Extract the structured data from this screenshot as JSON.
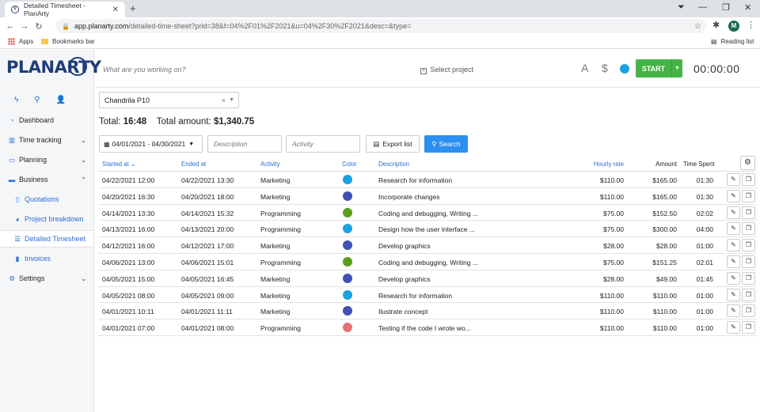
{
  "browser": {
    "tab_title": "Detailed Timesheet - PlanArty",
    "url_host": "app.planarty.com",
    "url_path": "/detailed-time-sheet?prid=38&f=04%2F01%2F2021&u=04%2F30%2F2021&desc=&type=",
    "profile_initial": "M",
    "bookmarks": {
      "apps": "Apps",
      "bookmarks_bar": "Bookmarks bar",
      "reading_list": "Reading list"
    }
  },
  "brand": {
    "logo": "PLANARTY"
  },
  "sidebar": {
    "items": [
      {
        "label": "Dashboard",
        "icon": "dashboard-icon"
      },
      {
        "label": "Time tracking",
        "icon": "chart-icon"
      },
      {
        "label": "Planning",
        "icon": "folder-icon"
      },
      {
        "label": "Business",
        "icon": "briefcase-icon"
      },
      {
        "label": "Quotations",
        "icon": "document-icon"
      },
      {
        "label": "Project breakdown",
        "icon": "pie-icon"
      },
      {
        "label": "Detailed Timesheet",
        "icon": "list-icon"
      },
      {
        "label": "Invoices",
        "icon": "invoice-icon"
      },
      {
        "label": "Settings",
        "icon": "gear-icon"
      }
    ]
  },
  "topbar": {
    "placeholder": "What are you working on?",
    "select_project": "Select project",
    "a_label": "A",
    "dollar_label": "$",
    "start_label": "START",
    "timer": "00:00:00",
    "accent": "#45b347"
  },
  "filters": {
    "project": "Chandrila P10",
    "total_label": "Total:",
    "total_time": "16:48",
    "amount_label": "Total amount:",
    "total_amount": "$1,340.75",
    "date_range": "04/01/2021 - 04/30/2021",
    "description_placeholder": "Description",
    "activity_placeholder": "Activity",
    "export_label": "Export list",
    "search_label": "Search"
  },
  "table": {
    "headers": {
      "started": "Started at",
      "ended": "Ended at",
      "activity": "Activity",
      "color": "Color",
      "description": "Description",
      "rate": "Hourly rate",
      "amount": "Amount",
      "time": "Time Spent"
    },
    "rows": [
      {
        "start": "04/22/2021  12:00",
        "end": "04/22/2021  13:30",
        "activity": "Marketing",
        "color": "#1ba1e2",
        "description": "Research for information",
        "rate": "$110.00",
        "amount": "$165.00",
        "time": "01:30"
      },
      {
        "start": "04/20/2021  16:30",
        "end": "04/20/2021  18:00",
        "activity": "Marketing",
        "color": "#3f51b5",
        "description": "Incorporate changes",
        "rate": "$110.00",
        "amount": "$165.00",
        "time": "01:30"
      },
      {
        "start": "04/14/2021  13:30",
        "end": "04/14/2021  15:32",
        "activity": "Programming",
        "color": "#5a9e1a",
        "description": "Coding and debugging, Writing ...",
        "rate": "$75.00",
        "amount": "$152.50",
        "time": "02:02"
      },
      {
        "start": "04/13/2021  16:00",
        "end": "04/13/2021  20:00",
        "activity": "Programming",
        "color": "#1ba1e2",
        "description": "Design how the user interface ...",
        "rate": "$75.00",
        "amount": "$300.00",
        "time": "04:00"
      },
      {
        "start": "04/12/2021  16:00",
        "end": "04/12/2021  17:00",
        "activity": "Marketing",
        "color": "#3f51b5",
        "description": "Develop graphics",
        "rate": "$28.00",
        "amount": "$28.00",
        "time": "01:00"
      },
      {
        "start": "04/06/2021  13:00",
        "end": "04/06/2021  15:01",
        "activity": "Programming",
        "color": "#5a9e1a",
        "description": "Coding and debugging, Writing ...",
        "rate": "$75.00",
        "amount": "$151.25",
        "time": "02:01"
      },
      {
        "start": "04/05/2021  15:00",
        "end": "04/05/2021  16:45",
        "activity": "Marketing",
        "color": "#3f51b5",
        "description": "Develop graphics",
        "rate": "$28.00",
        "amount": "$49.00",
        "time": "01:45"
      },
      {
        "start": "04/05/2021  08:00",
        "end": "04/05/2021  09:00",
        "activity": "Marketing",
        "color": "#1ba1e2",
        "description": "Research for information",
        "rate": "$110.00",
        "amount": "$110.00",
        "time": "01:00"
      },
      {
        "start": "04/01/2021  10:11",
        "end": "04/01/2021  11:11",
        "activity": "Marketing",
        "color": "#3f51b5",
        "description": "Ilustrate concept",
        "rate": "$110.00",
        "amount": "$110.00",
        "time": "01:00"
      },
      {
        "start": "04/01/2021  07:00",
        "end": "04/01/2021  08:00",
        "activity": "Programming",
        "color": "#e57373",
        "description": "Testing if the code I wrote wo...",
        "rate": "$110.00",
        "amount": "$110.00",
        "time": "01:00"
      }
    ]
  }
}
